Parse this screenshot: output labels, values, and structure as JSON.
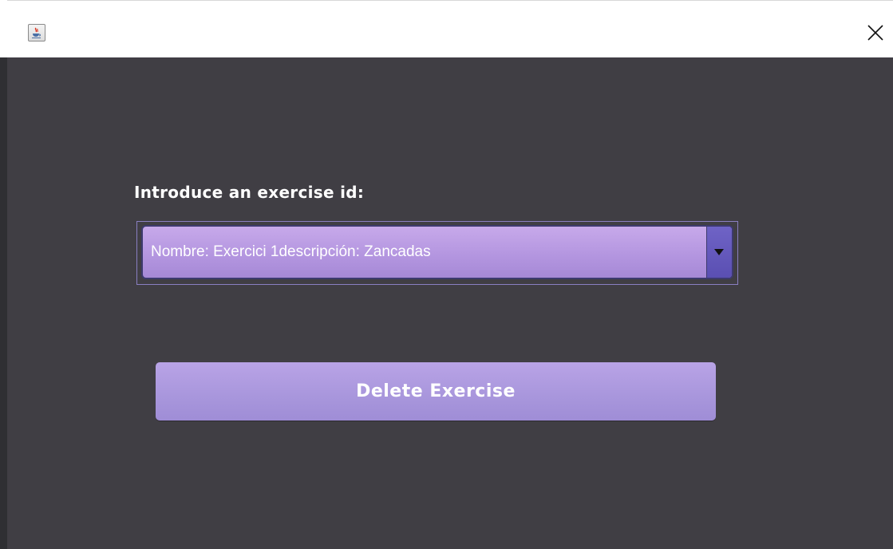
{
  "window": {
    "title": "",
    "icon": "java-cup-icon",
    "close_icon": "close-icon"
  },
  "form": {
    "prompt_label": "Introduce an exercise id:",
    "exercise_select": {
      "selected_value": "Nombre: Exercici 1descripción: Zancadas"
    },
    "delete_button_label": "Delete Exercise"
  },
  "colors": {
    "background": "#403e44",
    "accent": "#b496e0",
    "arrow": "#5a4fb2",
    "text": "#ffffff"
  }
}
